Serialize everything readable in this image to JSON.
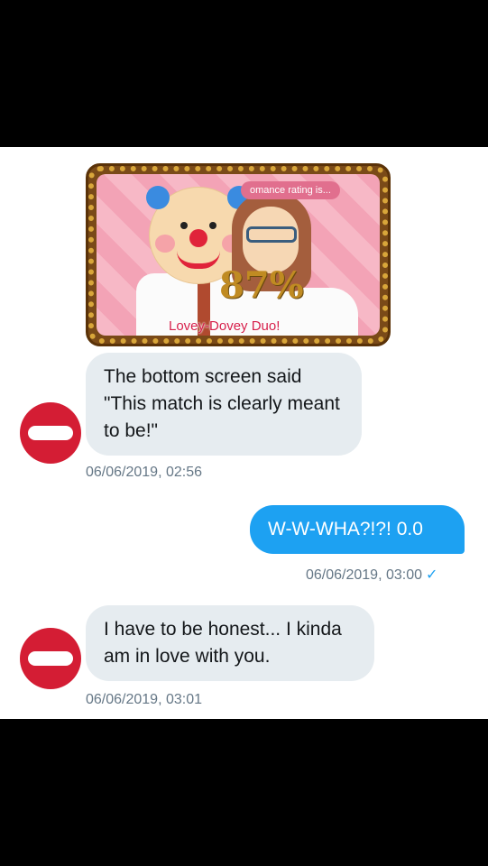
{
  "chat": {
    "image": {
      "rating_banner": "omance rating is...",
      "percent": "87%",
      "result": "Lovey-Dovey Duo!"
    },
    "messages": [
      {
        "direction": "in",
        "text": "The bottom screen said \"This match is clearly meant to be!\"",
        "timestamp": "06/06/2019, 02:56"
      },
      {
        "direction": "out",
        "text": "W-W-WHA?!?! 0.0",
        "timestamp": "06/06/2019, 03:00",
        "read_icon": "✓"
      },
      {
        "direction": "in",
        "text": "I have to be honest... I kinda am in love with you.",
        "timestamp": "06/06/2019, 03:01"
      }
    ]
  },
  "colors": {
    "incoming_bubble": "#e6ecf0",
    "outgoing_bubble": "#1da1f2",
    "avatar": "#d41d34",
    "timestamp": "#657786"
  },
  "icons": {
    "avatar": "no-entry-icon",
    "read_receipt": "checkmark-icon"
  }
}
